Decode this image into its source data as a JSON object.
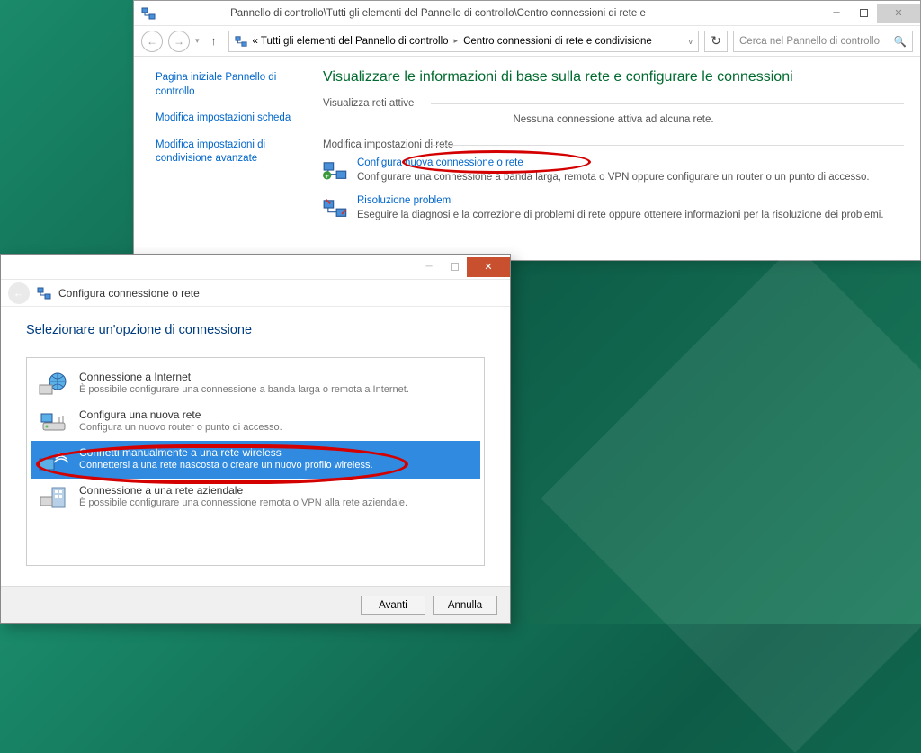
{
  "mainWindow": {
    "title": "Pannello di controllo\\Tutti gli elementi del Pannello di controllo\\Centro connessioni di rete e",
    "breadcrumb": {
      "prefix": "«  Tutti gli elementi del Pannello di controllo",
      "current": "Centro connessioni di rete e condivisione"
    },
    "searchPlaceholder": "Cerca nel Pannello di controllo",
    "sidebar": {
      "link1": "Pagina iniziale Pannello di controllo",
      "link2": "Modifica impostazioni scheda",
      "link3": "Modifica impostazioni di condivisione avanzate"
    },
    "main": {
      "heading": "Visualizzare le informazioni di base sulla rete e configurare le connessioni",
      "activeNetsLabel": "Visualizza reti attive",
      "noneActive": "Nessuna connessione attiva ad alcuna rete.",
      "modifyLabel": "Modifica impostazioni di rete",
      "configure": {
        "title": "Configura nuova connessione o rete",
        "desc": "Configurare una connessione a banda larga, remota o VPN oppure configurare un router o un punto di accesso."
      },
      "troubleshoot": {
        "title": "Risoluzione problemi",
        "desc": "Eseguire la diagnosi e la correzione di problemi di rete oppure ottenere informazioni per la risoluzione dei problemi."
      }
    }
  },
  "dialog": {
    "headerTitle": "Configura connessione o rete",
    "bodyTitle": "Selezionare un'opzione di connessione",
    "options": [
      {
        "title": "Connessione a Internet",
        "desc": "È possibile configurare una connessione a banda larga o remota a Internet."
      },
      {
        "title": "Configura una nuova rete",
        "desc": "Configura un nuovo router o punto di accesso."
      },
      {
        "title": "Connetti manualmente a una rete wireless",
        "desc": "Connettersi a una rete nascosta o creare un nuovo profilo wireless."
      },
      {
        "title": "Connessione a una rete aziendale",
        "desc": "È possibile configurare una connessione remota o VPN alla rete aziendale."
      }
    ],
    "buttons": {
      "next": "Avanti",
      "cancel": "Annulla"
    }
  }
}
